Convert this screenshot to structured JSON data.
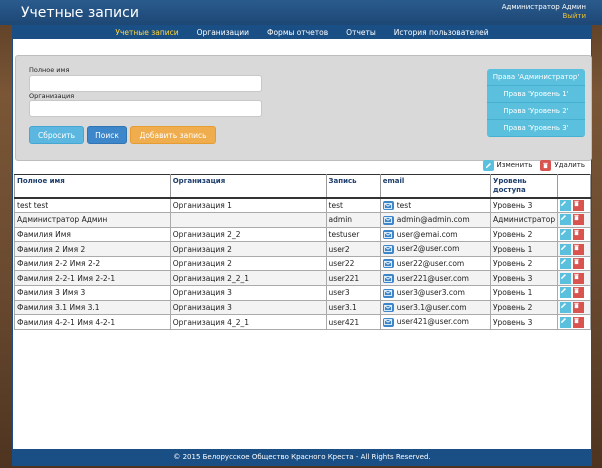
{
  "header": {
    "title": "Учетные записи",
    "user_name": "Администратор Админ",
    "logout_label": "Выйти"
  },
  "nav": {
    "items": [
      {
        "label": "Учетные записи",
        "active": true
      },
      {
        "label": "Организации",
        "active": false
      },
      {
        "label": "Формы отчетов",
        "active": false
      },
      {
        "label": "Отчеты",
        "active": false
      },
      {
        "label": "История пользователей",
        "active": false
      }
    ]
  },
  "filter": {
    "fullname_label": "Полное имя",
    "fullname_value": "",
    "org_label": "Организация",
    "org_value": "",
    "reset_label": "Сбросить",
    "search_label": "Поиск",
    "add_label": "Добавить запись"
  },
  "rights": [
    "Права 'Администратор'",
    "Права 'Уровень 1'",
    "Права 'Уровень 2'",
    "Права 'Уровень 3'"
  ],
  "legend": {
    "edit_label": "Изменить",
    "delete_label": "Удалить"
  },
  "table": {
    "headers": [
      "Полное имя",
      "Организация",
      "Запись",
      "email",
      "Уровень доступа"
    ],
    "rows": [
      {
        "name": "test test",
        "org": "Организация 1",
        "login": "test",
        "email": "test",
        "level": "Уровень 3"
      },
      {
        "name": "Администратор Админ",
        "org": "",
        "login": "admin",
        "email": "admin@admin.com",
        "level": "Администратор"
      },
      {
        "name": "Фамилия Имя",
        "org": "Организация 2_2",
        "login": "testuser",
        "email": "user@emai.com",
        "level": "Уровень 2"
      },
      {
        "name": "Фамилия 2 Имя 2",
        "org": "Организация 2",
        "login": "user2",
        "email": "user2@user.com",
        "level": "Уровень 1"
      },
      {
        "name": "Фамилия 2-2 Имя 2-2",
        "org": "Организация 2",
        "login": "user22",
        "email": "user22@user.com",
        "level": "Уровень 2"
      },
      {
        "name": "Фамилия 2-2-1 Имя 2-2-1",
        "org": "Организация 2_2_1",
        "login": "user221",
        "email": "user221@user.com",
        "level": "Уровень 3"
      },
      {
        "name": "Фамилия 3 Имя 3",
        "org": "Организация 3",
        "login": "user3",
        "email": "user3@user3.com",
        "level": "Уровень 1"
      },
      {
        "name": "Фамилия 3.1 Имя 3.1",
        "org": "Организация 3",
        "login": "user3.1",
        "email": "user3.1@user.com",
        "level": "Уровень 2"
      },
      {
        "name": "Фамилия 4-2-1 Имя 4-2-1",
        "org": "Организация 4_2_1",
        "login": "user421",
        "email": "user421@user.com",
        "level": "Уровень 3"
      }
    ]
  },
  "footer": {
    "text": "© 2015 Белорусское Общество Красного Креста  -   All Rights Reserved."
  },
  "colors": {
    "nav_bg": "#1a4f86",
    "nav_active": "#ffd83a",
    "edit": "#5bc0de",
    "delete": "#d9534f",
    "add": "#f0ad4e"
  }
}
